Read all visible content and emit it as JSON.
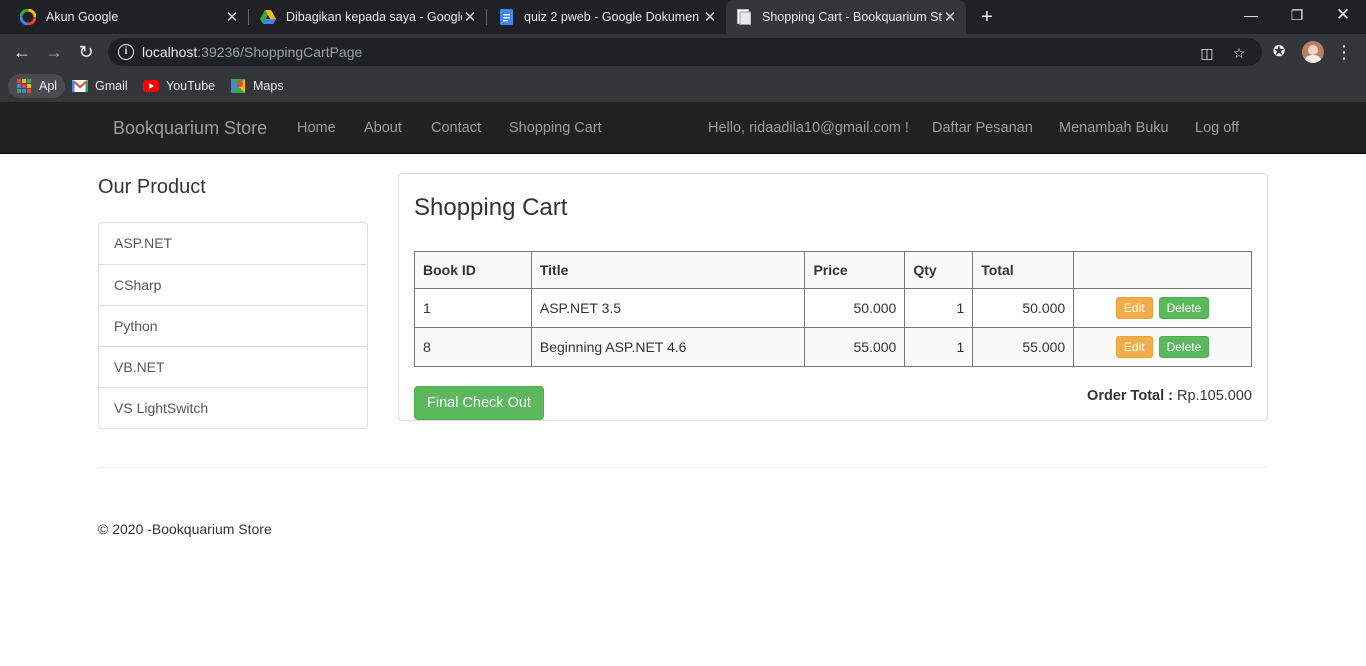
{
  "browser": {
    "tabs": [
      {
        "title": "Akun Google",
        "icon": "google-icon"
      },
      {
        "title": "Dibagikan kepada saya - Google",
        "icon": "google-drive-icon"
      },
      {
        "title": "quiz 2 pweb - Google Dokumen",
        "icon": "google-docs-icon"
      },
      {
        "title": "Shopping Cart - Bookquarium Sto",
        "icon": "page-icon"
      }
    ],
    "url_host": "localhost",
    "url_rest": ":39236/ShoppingCartPage",
    "bookmarks": [
      {
        "label": "Apl",
        "icon": "apps-grid-icon"
      },
      {
        "label": "Gmail",
        "icon": "gmail-icon"
      },
      {
        "label": "YouTube",
        "icon": "youtube-icon"
      },
      {
        "label": "Maps",
        "icon": "maps-icon"
      }
    ]
  },
  "site": {
    "brand": "Bookquarium Store",
    "nav_left": [
      "Home",
      "About",
      "Contact",
      "Shopping Cart"
    ],
    "greeting": "Hello, ridaadila10@gmail.com !",
    "nav_right": [
      "Daftar Pesanan",
      "Menambah Buku",
      "Log off"
    ]
  },
  "sidebar": {
    "title": "Our Product",
    "items": [
      "ASP.NET",
      "CSharp",
      "Python",
      "VB.NET",
      "VS LightSwitch"
    ]
  },
  "cart": {
    "title": "Shopping Cart",
    "columns": [
      "Book ID",
      "Title",
      "Price",
      "Qty",
      "Total"
    ],
    "rows": [
      {
        "id": "1",
        "title": "ASP.NET 3.5",
        "price": "50.000",
        "qty": "1",
        "total": "50.000"
      },
      {
        "id": "8",
        "title": "Beginning ASP.NET 4.6",
        "price": "55.000",
        "qty": "1",
        "total": "55.000"
      }
    ],
    "edit_label": "Edit",
    "delete_label": "Delete",
    "checkout_label": "Final Check Out",
    "order_total_label": "Order Total :",
    "order_total_value": "Rp.105.000"
  },
  "footer": {
    "text": "© 2020 -Bookquarium Store"
  }
}
